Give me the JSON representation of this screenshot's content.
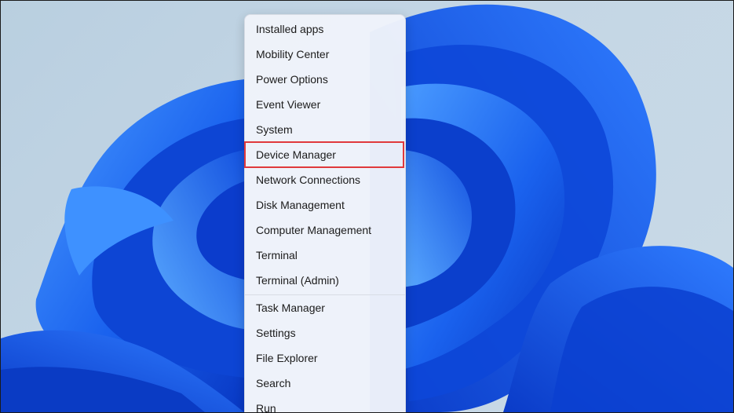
{
  "desktop": {
    "wallpaper_colors": {
      "sky": "#c4d6e5",
      "petal_dark": "#0a3fd0",
      "petal_mid": "#1a66f0",
      "petal_light": "#3c8cff"
    }
  },
  "quick_link_menu": {
    "highlight_color": "#e0393c",
    "group_one": [
      {
        "name": "installed-apps",
        "label": "Installed apps"
      },
      {
        "name": "mobility-center",
        "label": "Mobility Center"
      },
      {
        "name": "power-options",
        "label": "Power Options"
      },
      {
        "name": "event-viewer",
        "label": "Event Viewer"
      },
      {
        "name": "system",
        "label": "System"
      },
      {
        "name": "device-manager",
        "label": "Device Manager",
        "highlighted": true
      },
      {
        "name": "network-connections",
        "label": "Network Connections"
      },
      {
        "name": "disk-management",
        "label": "Disk Management"
      },
      {
        "name": "computer-management",
        "label": "Computer Management"
      },
      {
        "name": "terminal",
        "label": "Terminal"
      },
      {
        "name": "terminal-admin",
        "label": "Terminal (Admin)"
      }
    ],
    "group_two": [
      {
        "name": "task-manager",
        "label": "Task Manager"
      },
      {
        "name": "settings",
        "label": "Settings"
      },
      {
        "name": "file-explorer",
        "label": "File Explorer"
      },
      {
        "name": "search",
        "label": "Search"
      },
      {
        "name": "run",
        "label": "Run"
      }
    ]
  }
}
